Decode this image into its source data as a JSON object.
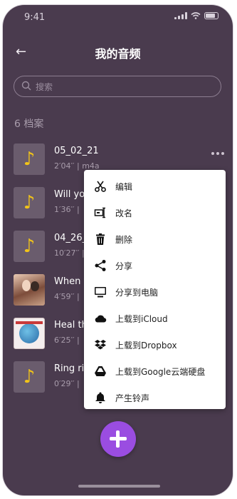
{
  "status_bar": {
    "time": "9:41"
  },
  "header": {
    "title": "我的音频",
    "back_icon": "←"
  },
  "search": {
    "placeholder": "搜索",
    "value": ""
  },
  "list": {
    "count_label": "6 档案",
    "items": [
      {
        "name": "05_02_21",
        "meta": "2′04′′ | m4a",
        "thumb": "music-note"
      },
      {
        "name": "Will yo",
        "meta": "1′36′′ |",
        "thumb": "music-note"
      },
      {
        "name": "04_26_",
        "meta": "10′27′′ |",
        "thumb": "music-note"
      },
      {
        "name": "When y",
        "meta": "4′59′′ |",
        "thumb": "album-art"
      },
      {
        "name": "Heal th",
        "meta": "6′25′′ |",
        "thumb": "album-art"
      },
      {
        "name": "Ring rir",
        "meta": "0′29′′ |",
        "thumb": "music-note"
      }
    ]
  },
  "context_menu": {
    "items": [
      {
        "label": "编辑",
        "icon": "scissors-icon"
      },
      {
        "label": "改名",
        "icon": "rename-icon"
      },
      {
        "label": "删除",
        "icon": "trash-icon"
      },
      {
        "label": "分享",
        "icon": "share-icon"
      },
      {
        "label": "分享到电脑",
        "icon": "monitor-icon"
      },
      {
        "label": "上载到iCloud",
        "icon": "cloud-icon"
      },
      {
        "label": "上载到Dropbox",
        "icon": "dropbox-icon"
      },
      {
        "label": "上载到Google云端硬盘",
        "icon": "google-drive-icon"
      },
      {
        "label": "产生铃声",
        "icon": "bell-icon"
      }
    ]
  },
  "colors": {
    "background": "#4a3b4e",
    "accent": "#9a4de1",
    "note": "#f2c418"
  }
}
